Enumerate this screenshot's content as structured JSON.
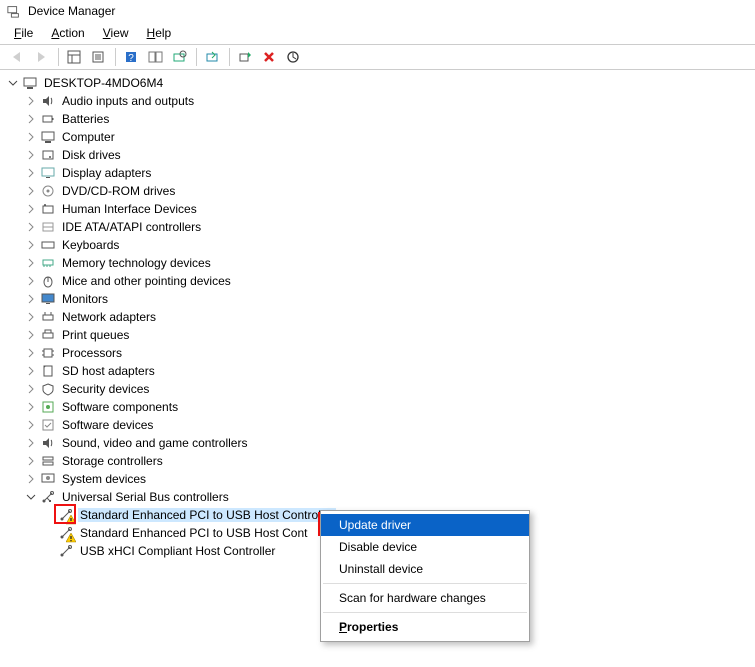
{
  "title": "Device Manager",
  "menu": {
    "file": "File",
    "action": "Action",
    "view": "View",
    "help": "Help"
  },
  "root_node": "DESKTOP-4MDO6M4",
  "categories": [
    "Audio inputs and outputs",
    "Batteries",
    "Computer",
    "Disk drives",
    "Display adapters",
    "DVD/CD-ROM drives",
    "Human Interface Devices",
    "IDE ATA/ATAPI controllers",
    "Keyboards",
    "Memory technology devices",
    "Mice and other pointing devices",
    "Monitors",
    "Network adapters",
    "Print queues",
    "Processors",
    "SD host adapters",
    "Security devices",
    "Software components",
    "Software devices",
    "Sound, video and game controllers",
    "Storage controllers",
    "System devices",
    "Universal Serial Bus controllers"
  ],
  "usb_children": [
    "Standard Enhanced PCI to USB Host Controller",
    "Standard Enhanced PCI to USB Host Cont",
    "USB xHCI Compliant Host Controller"
  ],
  "context": {
    "update": "Update driver",
    "disable": "Disable device",
    "uninstall": "Uninstall device",
    "scan": "Scan for hardware changes",
    "properties": "Properties"
  }
}
